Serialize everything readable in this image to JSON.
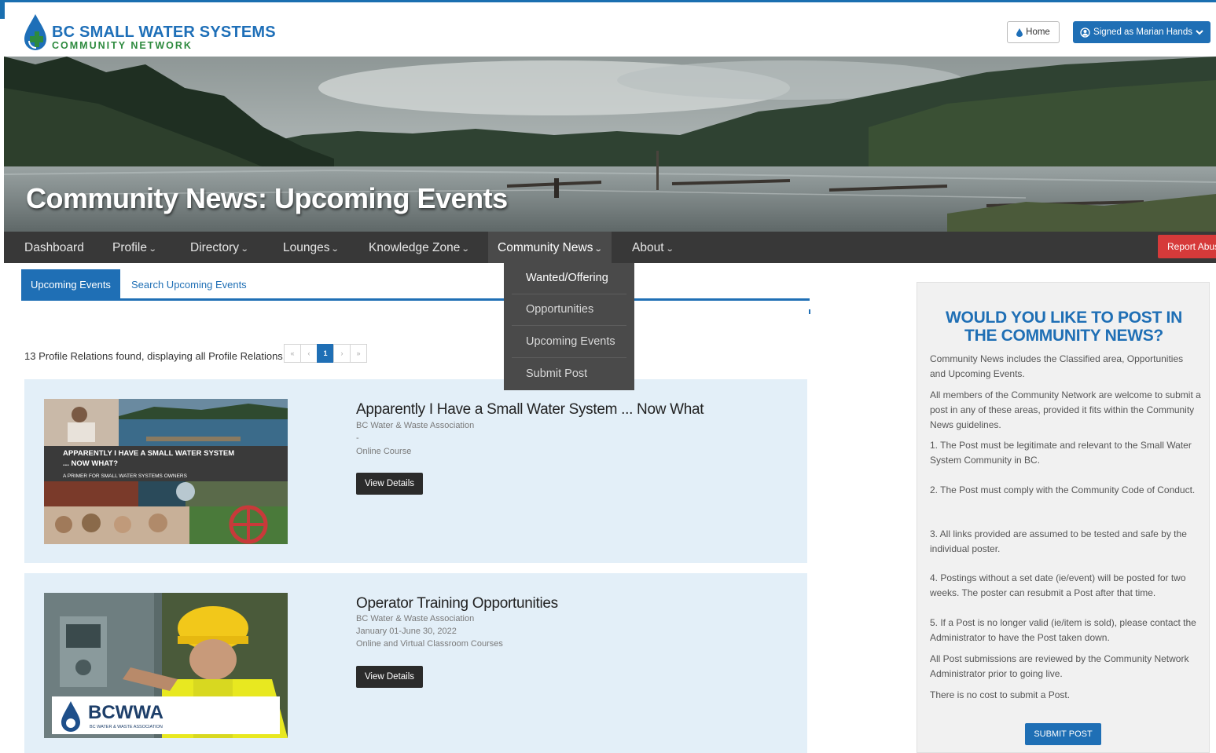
{
  "header": {
    "logo_title": "BC SMALL WATER SYSTEMS",
    "logo_subtitle": "COMMUNITY NETWORK",
    "home_label": "Home",
    "signed_label": "Signed as Marian Hands"
  },
  "banner": {
    "title": "Community News: Upcoming Events"
  },
  "nav": {
    "items": [
      {
        "label": "Dashboard"
      },
      {
        "label": "Profile"
      },
      {
        "label": "Directory"
      },
      {
        "label": "Lounges"
      },
      {
        "label": "Knowledge Zone"
      },
      {
        "label": "Community News"
      },
      {
        "label": "About"
      }
    ],
    "report_label": "Report Abuse"
  },
  "dropdown": {
    "items": [
      {
        "label": "Wanted/Offering"
      },
      {
        "label": "Opportunities"
      },
      {
        "label": "Upcoming Events"
      },
      {
        "label": "Submit Post"
      }
    ]
  },
  "tabs": {
    "active": "Upcoming Events",
    "search": "Search Upcoming Events"
  },
  "results": {
    "found_text": "13 Profile Relations found, displaying all Profile Relations.",
    "pager": {
      "prev_first": "«",
      "prev": "‹",
      "current": "1",
      "next": "›",
      "next_last": "»"
    }
  },
  "cards": [
    {
      "title": "Apparently I Have a Small Water System ... Now What",
      "org": "BC Water & Waste Association",
      "date": "-",
      "type": "Online Course",
      "button": "View Details",
      "thumb_caption_1": "APPARENTLY I HAVE A SMALL WATER SYSTEM",
      "thumb_caption_2": "... NOW WHAT?",
      "thumb_caption_3": "A PRIMER FOR SMALL WATER SYSTEMS OWNERS"
    },
    {
      "title": "Operator Training Opportunities",
      "org": "BC Water & Waste Association",
      "date": "January 01-June 30, 2022",
      "type": "Online and Virtual Classroom Courses",
      "button": "View Details",
      "thumb_logo": "BCWWA",
      "thumb_logo_sub": "BC WATER & WASTE ASSOCIATION"
    }
  ],
  "sidebar": {
    "title_line1": "WOULD YOU LIKE TO POST IN",
    "title_line2": "THE COMMUNITY NEWS?",
    "p1": "Community News includes the Classified area, Opportunities and Upcoming Events.",
    "p2": "All members of the Community Network are welcome to submit a post in any of these areas, provided it fits within the Community News guidelines.",
    "p3": "1. The Post must be legitimate and relevant to the Small Water System Community in BC.",
    "p4": "2. The Post must comply with the Community Code of Conduct.",
    "p5": "3. All links provided are assumed to be tested and safe by the individual poster.",
    "p6": "4. Postings without a set date (ie/event) will be posted for two weeks. The poster can resubmit a Post after that time.",
    "p7": "5. If a Post is no longer valid (ie/item is sold), please contact the Administrator to have the Post taken down.",
    "p8": "All Post submissions are reviewed by the Community Network Administrator prior to going live.",
    "p9": "There is no cost to submit a Post.",
    "button": "SUBMIT POST"
  },
  "colors": {
    "brand_blue": "#1f6fb5",
    "brand_green": "#2d8a3e",
    "nav_bg": "#383838",
    "report_red": "#d63a3a",
    "card_bg": "#e3eff8"
  },
  "icons": {
    "home": "water-drop-icon",
    "user": "user-circle-icon",
    "caret": "chevron-down-icon"
  }
}
